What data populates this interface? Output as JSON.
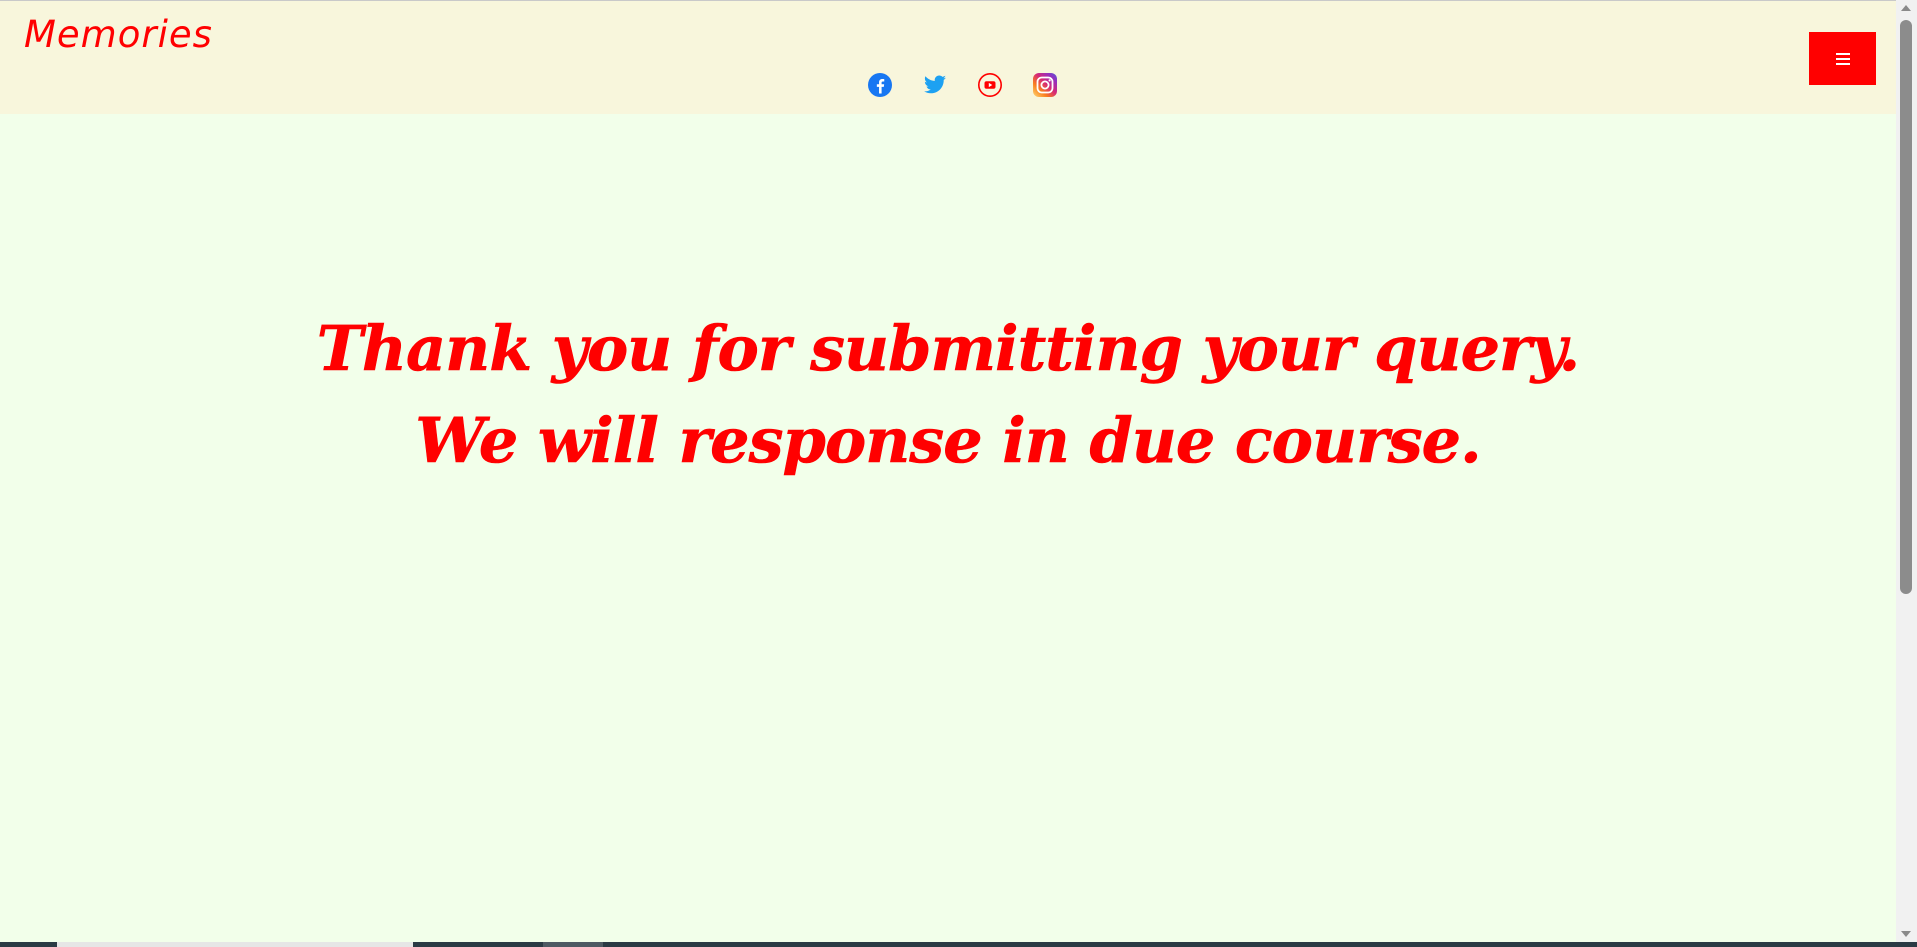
{
  "header": {
    "brand": "Memories",
    "menu_label": "☰",
    "social": [
      {
        "name": "facebook-icon",
        "color": "#1877f2"
      },
      {
        "name": "twitter-icon",
        "color": "#1da1f2"
      },
      {
        "name": "youtube-icon",
        "color": "#ff0000"
      },
      {
        "name": "instagram-icon",
        "color": "#c13584"
      }
    ]
  },
  "main": {
    "message_line1": "Thank you for submitting your query.",
    "message_line2": "We will response in due course."
  },
  "colors": {
    "accent": "#ff0000",
    "header_bg": "#f8f6dc",
    "page_bg": "#f2ffea"
  }
}
